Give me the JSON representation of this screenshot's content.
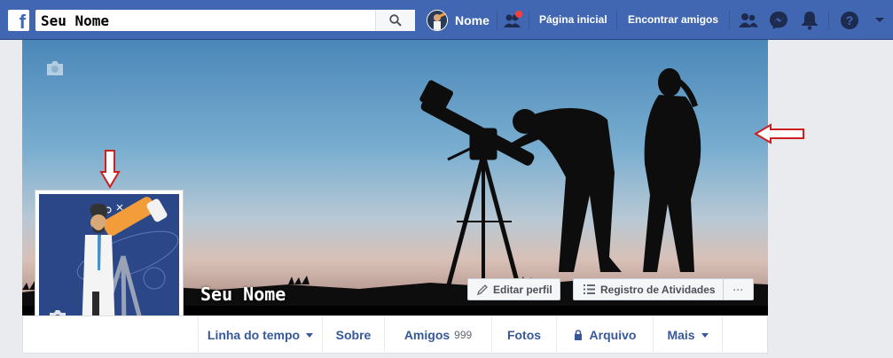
{
  "app": {
    "logo": "f"
  },
  "search": {
    "value": "Seu Nome",
    "icon": "search-icon"
  },
  "nav": {
    "user_name": "Nome",
    "home_label": "Página inicial",
    "find_friends_label": "Encontrar amigos",
    "icons": [
      "friend-requests-icon",
      "messenger-icon",
      "notifications-icon",
      "help-icon",
      "caret-down-icon"
    ]
  },
  "profile": {
    "name": "Seu Nome",
    "edit_button": "Editar perfil",
    "activity_button": "Registro de Atividades",
    "more_button": "···"
  },
  "tabs": {
    "timeline": "Linha do tempo",
    "about": "Sobre",
    "friends": "Amigos",
    "friends_count": "999",
    "photos": "Fotos",
    "archive": "Arquivo",
    "more": "Mais"
  },
  "colors": {
    "brand": "#4267b2",
    "link": "#365899",
    "annotation": "#cc1f1f"
  }
}
